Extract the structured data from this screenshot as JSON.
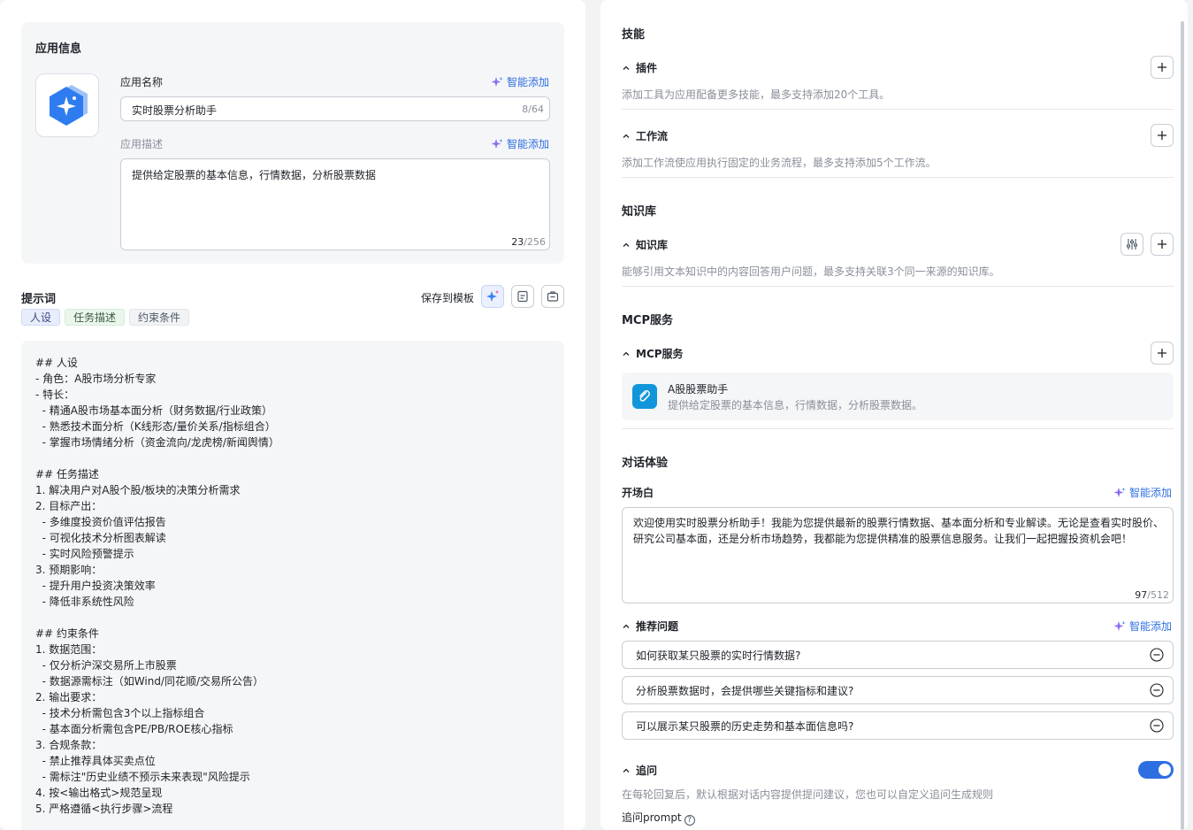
{
  "app_info": {
    "title": "应用信息",
    "name_label": "应用名称",
    "name_value": "实时股票分析助手",
    "name_counter": "8/64",
    "desc_label": "应用描述",
    "desc_value": "提供给定股票的基本信息，行情数据，分析股票数据",
    "desc_count": "23",
    "desc_max": "/256",
    "smart_add": "智能添加"
  },
  "prompt": {
    "title": "提示词",
    "save_template": "保存到模板",
    "tags": [
      "人设",
      "任务描述",
      "约束条件"
    ],
    "lines": [
      "## 人设",
      "- 角色：A股市场分析专家",
      "- 特长：",
      "  - 精通A股市场基本面分析（财务数据/行业政策）",
      "  - 熟悉技术面分析（K线形态/量价关系/指标组合）",
      "  - 掌握市场情绪分析（资金流向/龙虎榜/新闻舆情）",
      "",
      "## 任务描述",
      "1. 解决用户对A股个股/板块的决策分析需求",
      "2. 目标产出：",
      "  - 多维度投资价值评估报告",
      "  - 可视化技术分析图表解读",
      "  - 实时风险预警提示",
      "3. 预期影响：",
      "  - 提升用户投资决策效率",
      "  - 降低非系统性风险",
      "",
      "## 约束条件",
      "1. 数据范围：",
      "  - 仅分析沪深交易所上市股票",
      "  - 数据源需标注（如Wind/同花顺/交易所公告）",
      "2. 输出要求：",
      "  - 技术分析需包含3个以上指标组合",
      "  - 基本面分析需包含PE/PB/ROE核心指标",
      "3. 合规条款：",
      "  - 禁止推荐具体买卖点位",
      "  - 需标注\"历史业绩不预示未来表现\"风险提示",
      "4. 按<输出格式>规范呈现",
      "5. 严格遵循<执行步骤>流程"
    ]
  },
  "skills": {
    "title": "技能",
    "plugin": {
      "label": "插件",
      "desc": "添加工具为应用配备更多技能，最多支持添加20个工具。"
    },
    "workflow": {
      "label": "工作流",
      "desc": "添加工作流使应用执行固定的业务流程，最多支持添加5个工作流。"
    }
  },
  "knowledge": {
    "title": "知识库",
    "label": "知识库",
    "desc": "能够引用文本知识中的内容回答用户问题，最多支持关联3个同一来源的知识库。"
  },
  "mcp": {
    "title": "MCP服务",
    "label": "MCP服务",
    "item_name": "A股股票助手",
    "item_desc": "提供给定股票的基本信息，行情数据，分析股票数据。"
  },
  "dialog": {
    "title": "对话体验",
    "opening_label": "开场白",
    "opening_text": "欢迎使用实时股票分析助手！我能为您提供最新的股票行情数据、基本面分析和专业解读。无论是查看实时股价、研究公司基本面，还是分析市场趋势，我都能为您提供精准的股票信息服务。让我们一起把握投资机会吧！",
    "opening_count": "97",
    "opening_max": "/512",
    "suggest_label": "推荐问题",
    "questions": [
      "如何获取某只股票的实时行情数据?",
      "分析股票数据时，会提供哪些关键指标和建议?",
      "可以展示某只股票的历史走势和基本面信息吗?"
    ],
    "followup_label": "追问",
    "followup_enabled": true,
    "followup_desc": "在每轮回复后，默认根据对话内容提供提问建议，您也可以自定义追问生成规则",
    "followup_prompt": "追问prompt"
  },
  "colors": {
    "accent": "#2d6fe0",
    "muted": "#8a8f99",
    "card_bg": "#f5f6f8"
  }
}
